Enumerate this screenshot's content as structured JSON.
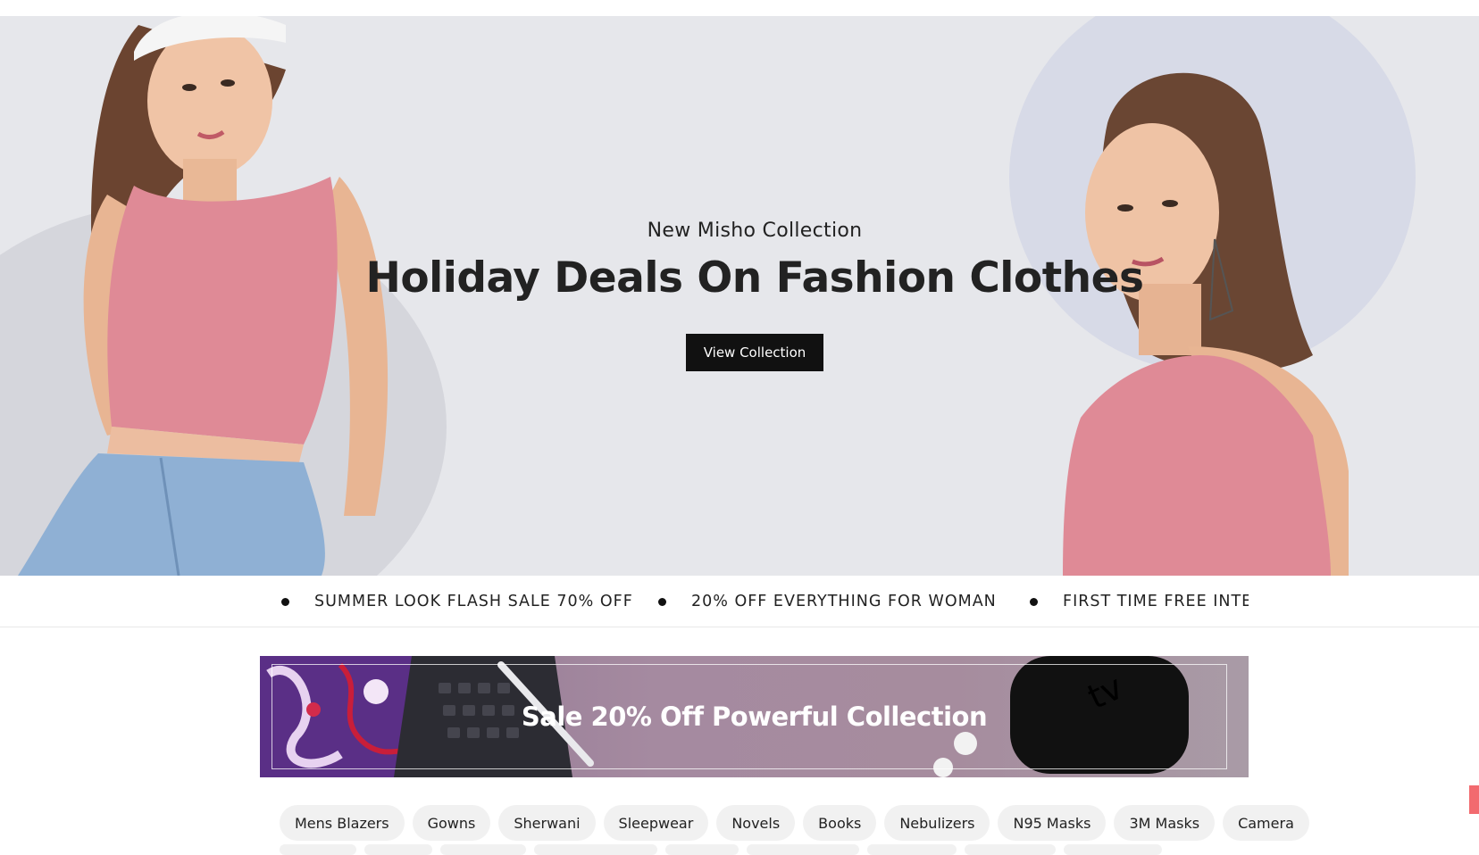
{
  "hero": {
    "subtitle": "New Misho Collection",
    "title": "Holiday Deals On Fashion Clothes",
    "button_label": "View Collection",
    "colors": {
      "background": "#e6e7eb",
      "button": "#111111"
    }
  },
  "ticker": {
    "items": [
      "SUMMER LOOK FLASH SALE 70% OFF",
      "20% OFF EVERYTHING FOR WOMAN",
      "FIRST TIME FREE INTERNATIONAL SHIPPING"
    ]
  },
  "banner": {
    "title": "Sale 20% Off Powerful Collection"
  },
  "tags": [
    "Mens Blazers",
    "Gowns",
    "Sherwani",
    "Sleepwear",
    "Novels",
    "Books",
    "Nebulizers",
    "N95 Masks",
    "3M Masks",
    "Camera"
  ],
  "accent_color": "#f26a6f"
}
